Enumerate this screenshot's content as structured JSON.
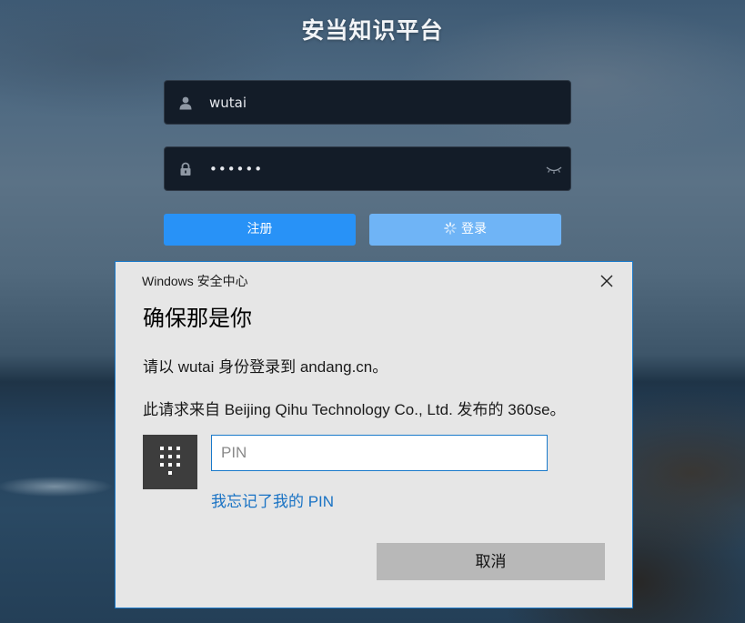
{
  "login_page": {
    "title": "安当知识平台",
    "username_value": "wutai",
    "password_value": "••••••",
    "register_label": "注册",
    "login_label": "登录"
  },
  "icons": {
    "user": "user-icon",
    "lock": "lock-icon",
    "eye": "eye-closed-icon",
    "spinner": "loading-spinner-icon",
    "close": "close-icon",
    "pin_keypad": "keypad-icon"
  },
  "dialog": {
    "caption": "Windows 安全中心",
    "heading": "确保那是你",
    "line1": "请以 wutai 身份登录到 andang.cn。",
    "line2": "此请求来自 Beijing Qihu Technology Co., Ltd. 发布的 360se。",
    "pin_placeholder": "PIN",
    "forgot_pin": "我忘记了我的 PIN",
    "cancel_label": "取消"
  },
  "colors": {
    "primary_button": "#2892f7",
    "login_button_loading": "#6fb4f6",
    "dialog_accent": "#1979ca",
    "link": "#1872c4"
  }
}
